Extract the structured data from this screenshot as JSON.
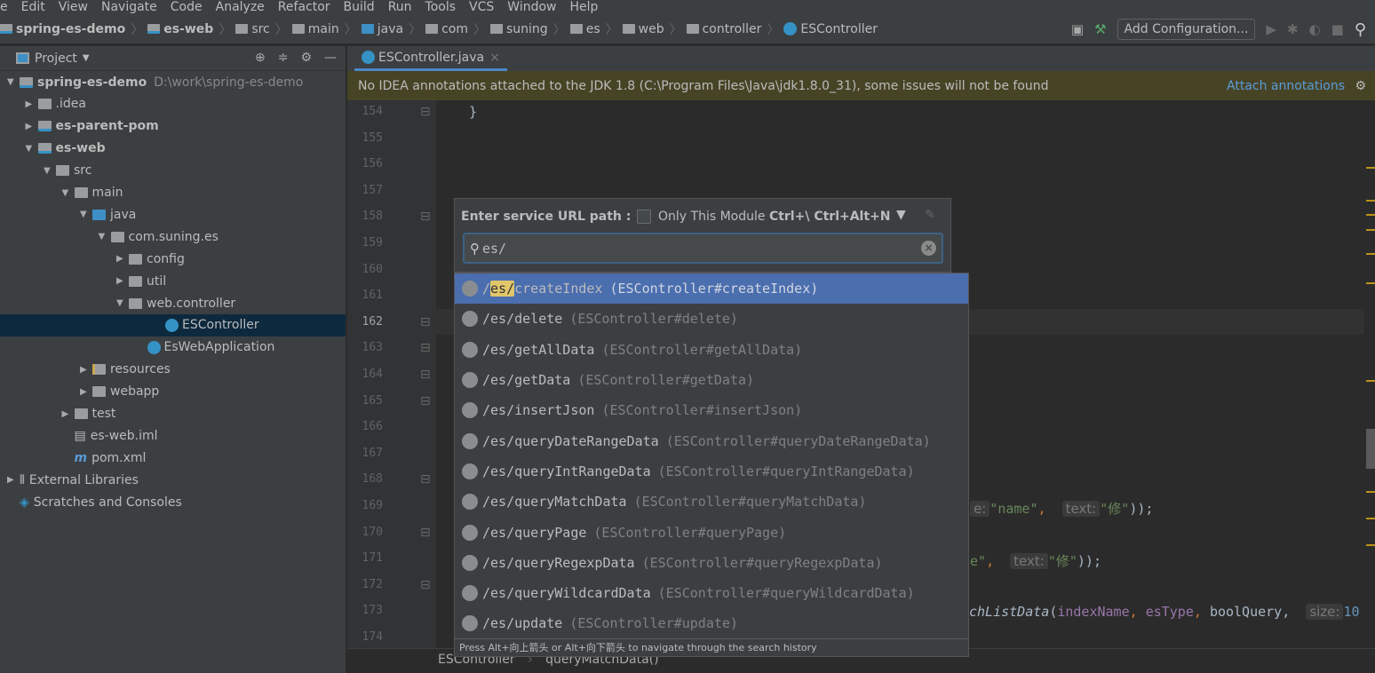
{
  "menu": [
    "e",
    "Edit",
    "View",
    "Navigate",
    "Code",
    "Analyze",
    "Refactor",
    "Build",
    "Run",
    "Tools",
    "VCS",
    "Window",
    "Help"
  ],
  "breadcrumbs": [
    {
      "label": "spring-es-demo",
      "kind": "mod",
      "bold": true
    },
    {
      "label": "es-web",
      "kind": "mod",
      "bold": true
    },
    {
      "label": "src",
      "kind": "folder"
    },
    {
      "label": "main",
      "kind": "folder"
    },
    {
      "label": "java",
      "kind": "src"
    },
    {
      "label": "com",
      "kind": "pkg"
    },
    {
      "label": "suning",
      "kind": "pkg"
    },
    {
      "label": "es",
      "kind": "pkg"
    },
    {
      "label": "web",
      "kind": "pkg"
    },
    {
      "label": "controller",
      "kind": "pkg"
    },
    {
      "label": "ESController",
      "kind": "class"
    }
  ],
  "toolbar": {
    "add_configuration": "Add Configuration..."
  },
  "project": {
    "title": "Project",
    "tree": [
      {
        "label": "spring-es-demo",
        "path": "D:\\work\\spring-es-demo",
        "level": 0,
        "arrow": "▼",
        "kind": "mod",
        "bold": true
      },
      {
        "label": ".idea",
        "level": 1,
        "arrow": "▶",
        "kind": "folder"
      },
      {
        "label": "es-parent-pom",
        "level": 1,
        "arrow": "▶",
        "kind": "mod",
        "bold": true
      },
      {
        "label": "es-web",
        "level": 1,
        "arrow": "▼",
        "kind": "mod",
        "bold": true
      },
      {
        "label": "src",
        "level": 2,
        "arrow": "▼",
        "kind": "folder"
      },
      {
        "label": "main",
        "level": 3,
        "arrow": "▼",
        "kind": "folder"
      },
      {
        "label": "java",
        "level": 4,
        "arrow": "▼",
        "kind": "src"
      },
      {
        "label": "com.suning.es",
        "level": 5,
        "arrow": "▼",
        "kind": "folder"
      },
      {
        "label": "config",
        "level": 6,
        "arrow": "▶",
        "kind": "folder"
      },
      {
        "label": "util",
        "level": 6,
        "arrow": "▶",
        "kind": "folder"
      },
      {
        "label": "web.controller",
        "level": 6,
        "arrow": "▼",
        "kind": "folder"
      },
      {
        "label": "ESController",
        "level": 8,
        "arrow": "",
        "kind": "class",
        "selected": true
      },
      {
        "label": "EsWebApplication",
        "level": 7,
        "arrow": "",
        "kind": "class"
      },
      {
        "label": "resources",
        "level": 4,
        "arrow": "▶",
        "kind": "res"
      },
      {
        "label": "webapp",
        "level": 4,
        "arrow": "▶",
        "kind": "folder"
      },
      {
        "label": "test",
        "level": 3,
        "arrow": "▶",
        "kind": "folder"
      },
      {
        "label": "es-web.iml",
        "level": 3,
        "arrow": "",
        "kind": "file"
      },
      {
        "label": "pom.xml",
        "level": 3,
        "arrow": "",
        "kind": "maven"
      },
      {
        "label": "External Libraries",
        "level": 0,
        "arrow": "▶",
        "kind": "lib"
      },
      {
        "label": "Scratches and Consoles",
        "level": 0,
        "arrow": "",
        "kind": "scratch"
      }
    ]
  },
  "editor": {
    "tab": "ESController.java",
    "banner": "No IDEA annotations attached to the JDK 1.8 (C:\\Program Files\\Java\\jdk1.8.0_31), some issues will not be found",
    "banner_link": "Attach annotations",
    "line_numbers": [
      154,
      155,
      156,
      157,
      158,
      159,
      160,
      161,
      162,
      163,
      164,
      165,
      166,
      167,
      168,
      169,
      170,
      171,
      172,
      173,
      174
    ],
    "current_line": 162,
    "code": {
      "l154": "}",
      "l169_a": "e:",
      "l169_b": "\"name\"",
      "l169_c": ",",
      "l169_d": "text:",
      "l169_e": "\"修\"",
      "l169_f": "));",
      "l171_a": "e\"",
      "l171_b": ",",
      "l171_c": "text:",
      "l171_d": "\"修\"",
      "l171_e": "));",
      "l173_a": "chListData",
      "l173_b": "(",
      "l173_c": "indexName",
      "l173_d": ",",
      "l173_e": "esType",
      "l173_f": ",",
      "l173_g": "boolQuery,",
      "l173_h": "size:",
      "l173_i": "10"
    },
    "breadcrumb": [
      "ESController",
      "queryMatchData()"
    ]
  },
  "popup": {
    "label": "Enter service URL path :",
    "only_module": "Only This Module",
    "shortcut": "Ctrl+\\ Ctrl+Alt+N",
    "only_module_checked": false,
    "search_value": "es/",
    "items": [
      {
        "url_pre": "/",
        "url_hl": "es/",
        "url_post": "createIndex",
        "method": "(ESController#createIndex)",
        "selected": true
      },
      {
        "url": "/es/delete",
        "method": "(ESController#delete)"
      },
      {
        "url": "/es/getAllData",
        "method": "(ESController#getAllData)"
      },
      {
        "url": "/es/getData",
        "method": "(ESController#getData)"
      },
      {
        "url": "/es/insertJson",
        "method": "(ESController#insertJson)"
      },
      {
        "url": "/es/queryDateRangeData",
        "method": "(ESController#queryDateRangeData)"
      },
      {
        "url": "/es/queryIntRangeData",
        "method": "(ESController#queryIntRangeData)"
      },
      {
        "url": "/es/queryMatchData",
        "method": "(ESController#queryMatchData)"
      },
      {
        "url": "/es/queryPage",
        "method": "(ESController#queryPage)"
      },
      {
        "url": "/es/queryRegexpData",
        "method": "(ESController#queryRegexpData)"
      },
      {
        "url": "/es/queryWildcardData",
        "method": "(ESController#queryWildcardData)"
      },
      {
        "url": "/es/update",
        "method": "(ESController#update)"
      }
    ],
    "hint": "Press Alt+向上箭头 or Alt+向下箭头 to navigate through the search history"
  },
  "colors": {
    "selection": "#4b6eaf",
    "banner": "#474426",
    "link": "#5a9bd9",
    "match_highlight": "#e1c66a"
  }
}
